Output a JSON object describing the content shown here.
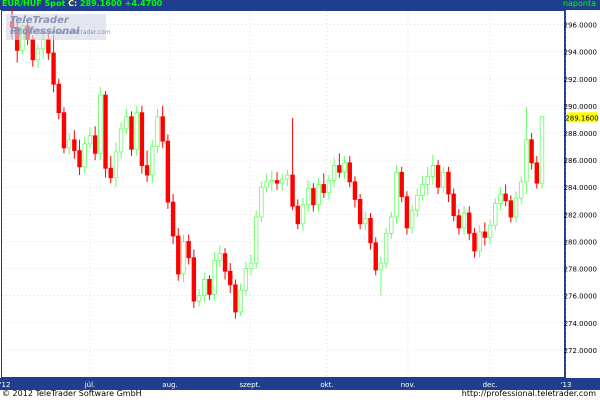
{
  "header": {
    "symbol": "EUR/HUF Spot",
    "close_label": "C:",
    "close_value": "289.1600",
    "change": "+4.4700",
    "period": "naponta"
  },
  "logo": {
    "title": "TeleTrader Professional",
    "url": "http://professional.teletrader.com"
  },
  "footer": {
    "copyright": "© 2012 TeleTrader Software GmbH",
    "url": "http://professional.teletrader.com"
  },
  "colors": {
    "up": "#66ff66",
    "down": "#ff0000",
    "frame": "#1f3f8e",
    "grid": "#cccccc",
    "last_price_bg": "#ffff00"
  },
  "chart_data": {
    "type": "candlestick",
    "title": "EUR/HUF Spot",
    "ylim": [
      270,
      297
    ],
    "y_ticks": [
      "296.0000",
      "294.0000",
      "292.0000",
      "290.0000",
      "288.0000",
      "286.0000",
      "284.0000",
      "282.0000",
      "280.0000",
      "278.0000",
      "276.0000",
      "274.0000",
      "272.0000"
    ],
    "y_tick_values": [
      296,
      294,
      292,
      290,
      288,
      286,
      284,
      282,
      280,
      278,
      276,
      274,
      272
    ],
    "x_ticks": [
      "'12",
      "júl.",
      "aug.",
      "szept.",
      "okt.",
      "nov.",
      "dec.",
      "'13"
    ],
    "last_price": "289.1600",
    "grid": true,
    "candles": [
      [
        296.2,
        297.2,
        294.9,
        295.8
      ],
      [
        295.8,
        296.6,
        293.2,
        294.1
      ],
      [
        294.1,
        296.3,
        293.8,
        295.9
      ],
      [
        295.9,
        296.4,
        294.5,
        294.9
      ],
      [
        294.9,
        295.2,
        292.9,
        293.4
      ],
      [
        293.4,
        294.5,
        292.8,
        294.2
      ],
      [
        294.2,
        295.4,
        293.5,
        294.9
      ],
      [
        294.9,
        295.3,
        293.4,
        293.9
      ],
      [
        293.9,
        295.2,
        291.0,
        291.6
      ],
      [
        291.6,
        292.0,
        289.0,
        289.5
      ],
      [
        289.5,
        289.9,
        286.5,
        286.9
      ],
      [
        286.9,
        288.0,
        286.4,
        287.5
      ],
      [
        287.5,
        288.2,
        286.1,
        286.7
      ],
      [
        286.7,
        287.5,
        284.9,
        285.5
      ],
      [
        285.5,
        287.7,
        285.0,
        287.2
      ],
      [
        287.2,
        288.4,
        286.9,
        287.8
      ],
      [
        287.8,
        288.5,
        286.0,
        286.5
      ],
      [
        286.5,
        291.4,
        286.0,
        290.8
      ],
      [
        290.8,
        291.1,
        284.7,
        285.4
      ],
      [
        285.4,
        286.3,
        284.3,
        284.7
      ],
      [
        284.7,
        287.3,
        284.0,
        286.6
      ],
      [
        286.6,
        288.8,
        286.1,
        288.3
      ],
      [
        288.3,
        289.8,
        287.9,
        289.2
      ],
      [
        289.2,
        289.6,
        286.3,
        286.8
      ],
      [
        286.8,
        290.0,
        286.3,
        289.5
      ],
      [
        289.5,
        290.0,
        285.0,
        285.6
      ],
      [
        285.6,
        286.7,
        284.4,
        284.9
      ],
      [
        284.9,
        287.5,
        284.3,
        287.0
      ],
      [
        287.0,
        289.8,
        286.5,
        289.2
      ],
      [
        289.2,
        290.0,
        286.9,
        287.4
      ],
      [
        287.4,
        287.9,
        282.4,
        282.9
      ],
      [
        282.9,
        283.5,
        279.8,
        280.4
      ],
      [
        280.4,
        281.0,
        277.1,
        277.6
      ],
      [
        277.6,
        280.5,
        277.0,
        280.0
      ],
      [
        280.0,
        280.5,
        278.3,
        278.8
      ],
      [
        278.8,
        279.4,
        275.1,
        275.6
      ],
      [
        275.6,
        276.5,
        275.2,
        276.0
      ],
      [
        276.0,
        277.7,
        275.5,
        277.2
      ],
      [
        277.2,
        277.5,
        275.7,
        276.1
      ],
      [
        276.1,
        279.2,
        275.6,
        278.6
      ],
      [
        278.6,
        279.7,
        278.1,
        279.1
      ],
      [
        279.1,
        279.5,
        277.2,
        277.8
      ],
      [
        277.8,
        278.4,
        276.2,
        276.8
      ],
      [
        276.8,
        277.2,
        274.3,
        274.8
      ],
      [
        274.8,
        276.9,
        274.5,
        276.4
      ],
      [
        276.4,
        278.5,
        276.0,
        278.0
      ],
      [
        278.0,
        279.0,
        277.5,
        278.4
      ],
      [
        278.4,
        282.3,
        278.0,
        281.8
      ],
      [
        281.8,
        284.4,
        281.4,
        284.0
      ],
      [
        284.0,
        285.0,
        283.6,
        284.4
      ],
      [
        284.4,
        285.2,
        283.7,
        284.5
      ],
      [
        284.5,
        285.1,
        283.8,
        284.3
      ],
      [
        284.3,
        285.0,
        283.7,
        284.6
      ],
      [
        284.6,
        285.3,
        284.1,
        284.9
      ],
      [
        284.9,
        289.1,
        282.3,
        282.6
      ],
      [
        282.6,
        283.1,
        280.9,
        281.3
      ],
      [
        281.3,
        283.2,
        280.8,
        282.7
      ],
      [
        282.7,
        284.5,
        282.2,
        283.9
      ],
      [
        283.9,
        284.3,
        282.2,
        282.7
      ],
      [
        282.7,
        284.7,
        282.2,
        284.2
      ],
      [
        284.2,
        285.0,
        283.2,
        283.6
      ],
      [
        283.6,
        284.9,
        283.1,
        284.5
      ],
      [
        284.5,
        286.2,
        284.0,
        285.6
      ],
      [
        285.6,
        286.5,
        284.7,
        285.1
      ],
      [
        285.1,
        286.3,
        284.6,
        285.8
      ],
      [
        285.8,
        286.3,
        284.0,
        284.4
      ],
      [
        284.4,
        284.8,
        282.5,
        283.1
      ],
      [
        283.1,
        283.5,
        280.9,
        281.3
      ],
      [
        281.3,
        282.2,
        280.8,
        281.7
      ],
      [
        281.7,
        282.1,
        279.4,
        279.9
      ],
      [
        279.9,
        280.3,
        277.5,
        277.9
      ],
      [
        277.9,
        278.9,
        276.0,
        278.4
      ],
      [
        278.4,
        281.0,
        278.0,
        280.6
      ],
      [
        280.6,
        282.2,
        280.2,
        281.8
      ],
      [
        281.8,
        285.6,
        281.3,
        285.1
      ],
      [
        285.1,
        285.5,
        282.9,
        283.3
      ],
      [
        283.3,
        283.7,
        280.5,
        281.0
      ],
      [
        281.0,
        282.7,
        280.6,
        282.3
      ],
      [
        282.3,
        283.9,
        281.8,
        283.4
      ],
      [
        283.4,
        284.8,
        283.0,
        284.2
      ],
      [
        284.2,
        285.5,
        283.4,
        284.8
      ],
      [
        284.8,
        286.4,
        284.2,
        285.6
      ],
      [
        285.6,
        286.0,
        283.5,
        284.0
      ],
      [
        284.0,
        285.5,
        283.6,
        285.1
      ],
      [
        285.1,
        285.5,
        282.9,
        283.5
      ],
      [
        283.5,
        283.9,
        281.5,
        281.9
      ],
      [
        281.9,
        282.4,
        280.5,
        281.0
      ],
      [
        281.0,
        282.6,
        280.5,
        282.1
      ],
      [
        282.1,
        282.6,
        280.1,
        280.6
      ],
      [
        280.6,
        281.0,
        278.8,
        279.3
      ],
      [
        279.3,
        281.2,
        278.8,
        280.7
      ],
      [
        280.7,
        281.4,
        279.7,
        280.3
      ],
      [
        280.3,
        281.6,
        279.8,
        281.2
      ],
      [
        281.2,
        283.2,
        280.8,
        282.8
      ],
      [
        282.8,
        284.0,
        282.3,
        283.5
      ],
      [
        283.5,
        284.2,
        282.6,
        283.0
      ],
      [
        283.0,
        283.4,
        281.4,
        281.8
      ],
      [
        281.8,
        283.7,
        281.4,
        283.2
      ],
      [
        283.2,
        284.8,
        282.8,
        284.4
      ],
      [
        284.4,
        289.9,
        283.5,
        287.5
      ],
      [
        287.5,
        288.0,
        285.3,
        285.8
      ],
      [
        285.8,
        286.3,
        283.9,
        284.3
      ],
      [
        284.3,
        288.8,
        283.9,
        289.2
      ]
    ]
  }
}
